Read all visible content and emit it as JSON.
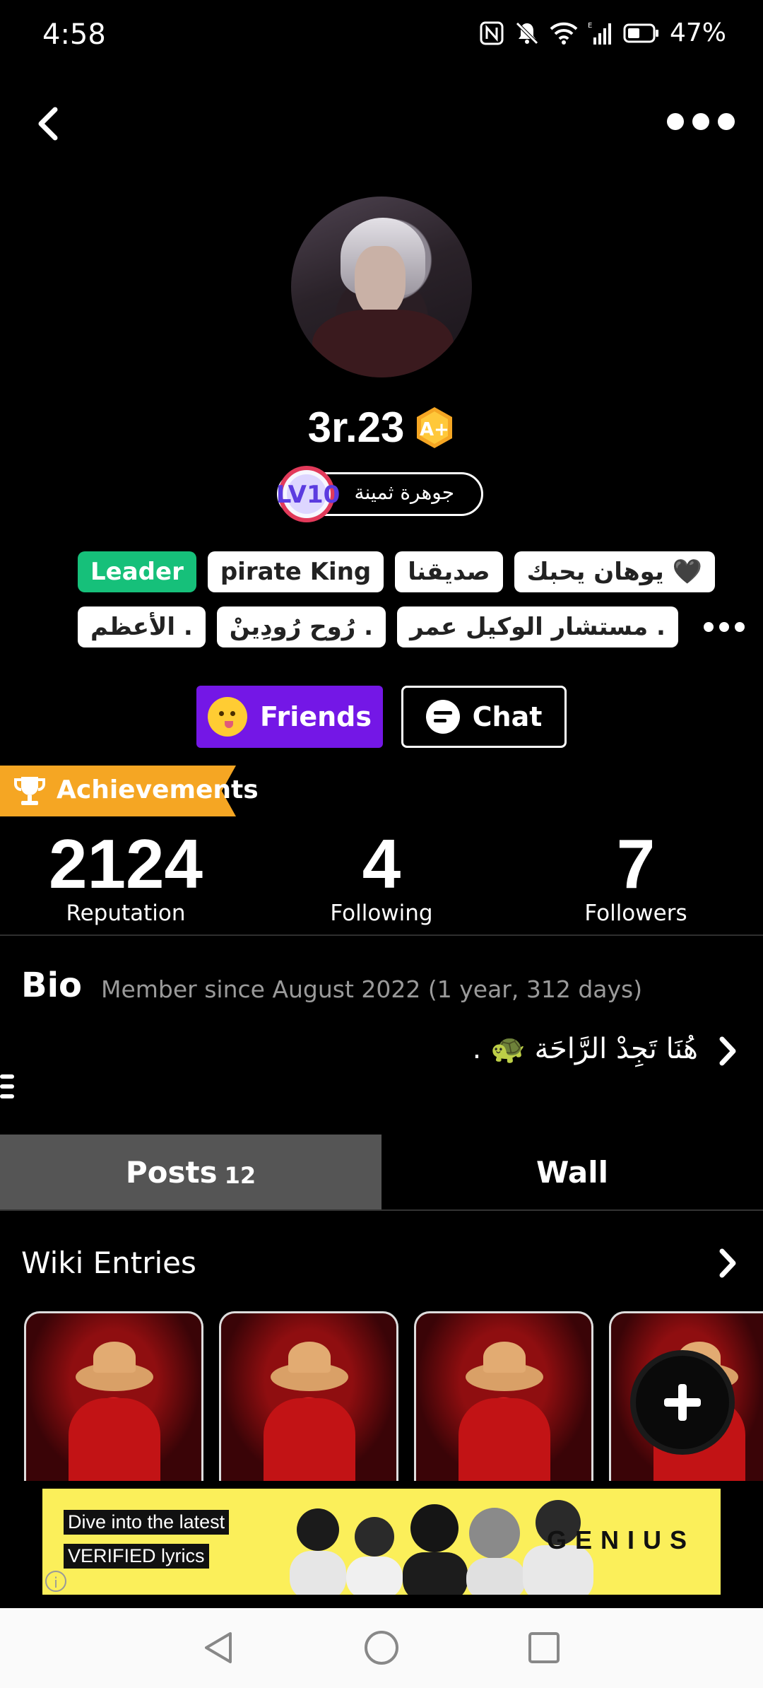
{
  "status_bar": {
    "time": "4:58",
    "battery": "47%",
    "icons": [
      "nfc-icon",
      "mute-icon",
      "wifi-icon",
      "signal-icon",
      "battery-icon"
    ]
  },
  "header": {
    "back_icon": "back-arrow-icon",
    "more_icon": "more-dots-icon"
  },
  "profile": {
    "username": "3r.23",
    "verified_badge": "A+",
    "level_badge": "LV10",
    "level_title": "جوهرة ثمينة",
    "tags_row1": [
      "Leader",
      "pirate King",
      "صديقنا",
      "يوهان يحبك 🖤"
    ],
    "tags_row2": [
      "الأعظم .",
      "رُوح رُودِينْ .",
      "مستشار الوكيل عمر ."
    ]
  },
  "actions": {
    "friends_label": "Friends",
    "chat_label": "Chat"
  },
  "achievements": {
    "label": "Achievements"
  },
  "stats": {
    "reputation": {
      "value": "2124",
      "label": "Reputation"
    },
    "following": {
      "value": "4",
      "label": "Following"
    },
    "followers": {
      "value": "7",
      "label": "Followers"
    }
  },
  "bio": {
    "title": "Bio",
    "member_since": "Member since August 2022 (1 year, 312 days)",
    "text": "هُنَا تَجِدْ الرَّاحَة 🐢 ."
  },
  "tabs": {
    "posts_label": "Posts",
    "posts_count": "12",
    "wall_label": "Wall"
  },
  "wiki": {
    "title": "Wiki Entries"
  },
  "ad": {
    "line1": "Dive into the latest",
    "line2": "VERIFIED lyrics",
    "brand": "GENIUS",
    "info": "i"
  },
  "colors": {
    "leader_tag": "#16c07a",
    "friends_button": "#7417e6",
    "achievements": "#f5a623",
    "ad_background": "#fbef5a"
  }
}
